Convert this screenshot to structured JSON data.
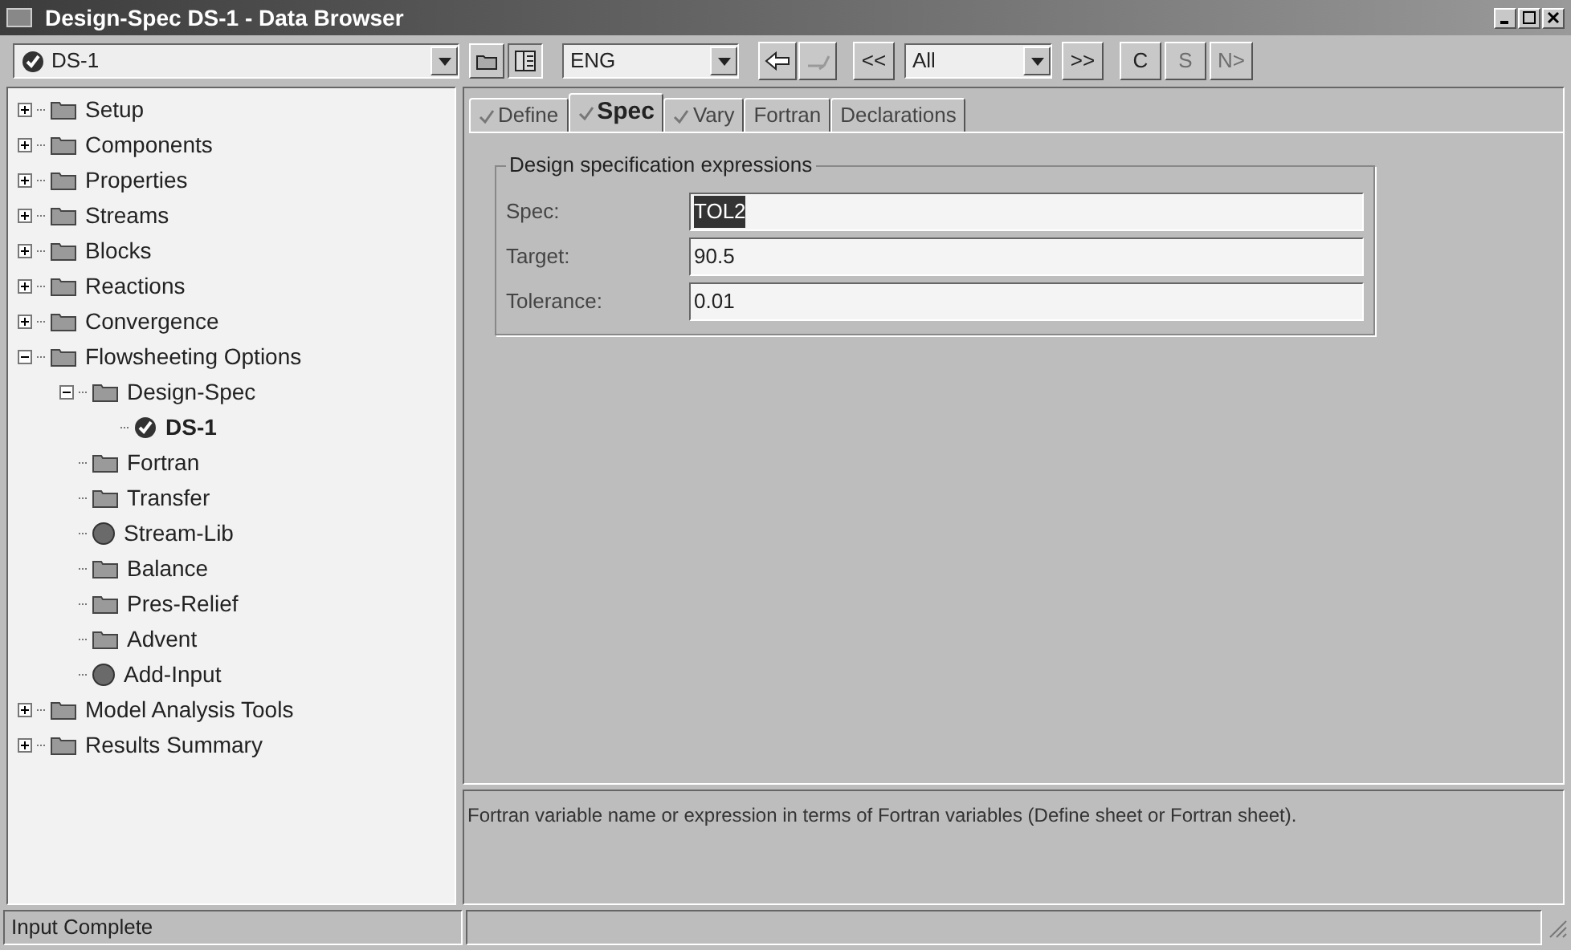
{
  "window": {
    "title": "Design-Spec DS-1 - Data Browser"
  },
  "toolbar": {
    "object_select": {
      "kind": "check",
      "value": "DS-1"
    },
    "units": {
      "value": "ENG"
    },
    "back": {
      "disabled": false
    },
    "forward": {
      "disabled": true
    },
    "prev": {
      "label": "<<"
    },
    "filter": {
      "value": "All"
    },
    "next": {
      "label": ">>"
    },
    "buttons": [
      {
        "label": "C",
        "disabled": false
      },
      {
        "label": "S",
        "disabled": true
      },
      {
        "label": "N>",
        "disabled": true
      }
    ]
  },
  "tree": [
    {
      "label": "Setup",
      "kind": "folder",
      "expanded": false,
      "selected": false
    },
    {
      "label": "Components",
      "kind": "folder",
      "expanded": false,
      "selected": false
    },
    {
      "label": "Properties",
      "kind": "folder",
      "expanded": false,
      "selected": false
    },
    {
      "label": "Streams",
      "kind": "folder",
      "expanded": false,
      "selected": false
    },
    {
      "label": "Blocks",
      "kind": "folder",
      "expanded": false,
      "selected": false
    },
    {
      "label": "Reactions",
      "kind": "folder",
      "expanded": false,
      "selected": false
    },
    {
      "label": "Convergence",
      "kind": "folder",
      "expanded": false,
      "selected": false
    },
    {
      "label": "Flowsheeting Options",
      "kind": "folder",
      "expanded": true,
      "selected": false,
      "children": [
        {
          "label": "Design-Spec",
          "kind": "folder",
          "expanded": true,
          "selected": false,
          "children": [
            {
              "label": "DS-1",
              "kind": "check",
              "selected": true
            }
          ]
        },
        {
          "label": "Fortran",
          "kind": "folder",
          "selected": false
        },
        {
          "label": "Transfer",
          "kind": "folder",
          "selected": false
        },
        {
          "label": "Stream-Lib",
          "kind": "circle",
          "selected": false
        },
        {
          "label": "Balance",
          "kind": "folder",
          "selected": false
        },
        {
          "label": "Pres-Relief",
          "kind": "folder",
          "selected": false
        },
        {
          "label": "Advent",
          "kind": "folder",
          "selected": false
        },
        {
          "label": "Add-Input",
          "kind": "circle",
          "selected": false
        }
      ]
    },
    {
      "label": "Model Analysis Tools",
      "kind": "folder",
      "expanded": false,
      "selected": false
    },
    {
      "label": "Results Summary",
      "kind": "folder",
      "expanded": false,
      "selected": false
    }
  ],
  "tabs": [
    {
      "label": "Define",
      "checked": true,
      "selected": false
    },
    {
      "label": "Spec",
      "checked": true,
      "selected": true
    },
    {
      "label": "Vary",
      "checked": true,
      "selected": false
    },
    {
      "label": "Fortran",
      "checked": false,
      "selected": false
    },
    {
      "label": "Declarations",
      "checked": false,
      "selected": false
    }
  ],
  "group": {
    "title": "Design specification expressions",
    "fields": [
      {
        "label": "Spec:",
        "value": "TOL2",
        "selected": true
      },
      {
        "label": "Target:",
        "value": "90.5",
        "selected": false
      },
      {
        "label": "Tolerance:",
        "value": "0.01",
        "selected": false
      }
    ]
  },
  "description": "Fortran variable name or expression in terms of Fortran variables (Define sheet or Fortran sheet).",
  "status_bar": "Input Complete"
}
